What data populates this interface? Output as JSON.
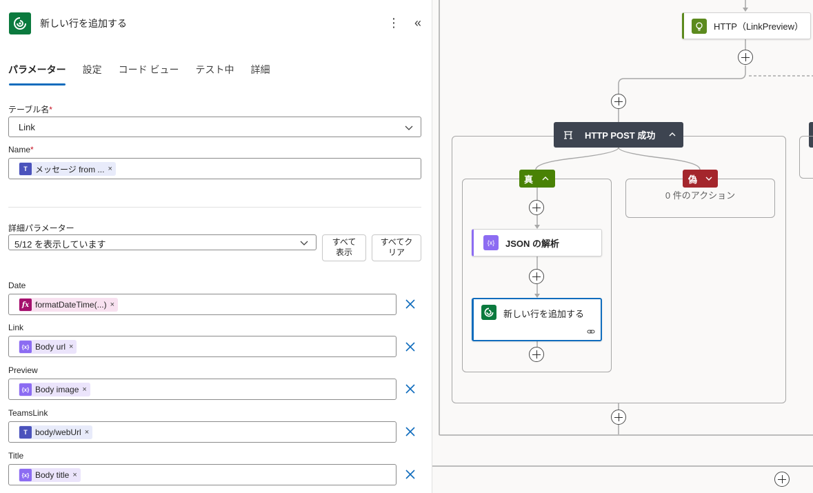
{
  "panel": {
    "title": "新しい行を追加する",
    "more_icon": "more-vertical-icon",
    "collapse_icon": "chevron-double-left-icon",
    "tabs": [
      {
        "label": "パラメーター",
        "active": true
      },
      {
        "label": "設定"
      },
      {
        "label": "コード ビュー"
      },
      {
        "label": "テスト中"
      },
      {
        "label": "詳細"
      }
    ],
    "table_name": {
      "label": "テーブル名",
      "required": "*",
      "value": "Link"
    },
    "name_field": {
      "label": "Name",
      "required": "*",
      "token": "メッセージ from ...",
      "remove": "×"
    },
    "advanced": {
      "label": "詳細パラメーター",
      "value": "5/12 を表示しています",
      "show_all_line1": "すべて",
      "show_all_line2": "表示",
      "clear_all_line1": "すべてク",
      "clear_all_line2": "リア"
    },
    "params": [
      {
        "label": "Date",
        "token": "formatDateTime(...)",
        "kind": "fx",
        "remove": "×"
      },
      {
        "label": "Link",
        "token": "Body url",
        "kind": "var",
        "remove": "×"
      },
      {
        "label": "Preview",
        "token": "Body image",
        "kind": "var",
        "remove": "×"
      },
      {
        "label": "TeamsLink",
        "token": "body/webUrl",
        "kind": "teams",
        "remove": "×"
      },
      {
        "label": "Title",
        "token": "Body title",
        "kind": "var",
        "remove": "×"
      }
    ]
  },
  "canvas": {
    "http_node": "HTTP（LinkPreview）",
    "condition": "HTTP POST 成功",
    "true_branch": "真",
    "false_branch": "偽",
    "empty_false": "0 件のアクション",
    "parse_json": "JSON の解析",
    "add_row": "新しい行を追加する",
    "colors": {
      "dataverse": "#0b7a3e",
      "http": "#5c8a1e",
      "true_branch": "#498205",
      "false_branch": "#a4262c",
      "condition": "#3d4450",
      "variable": "#8c6cf2",
      "selected": "#0f6cbd"
    }
  }
}
